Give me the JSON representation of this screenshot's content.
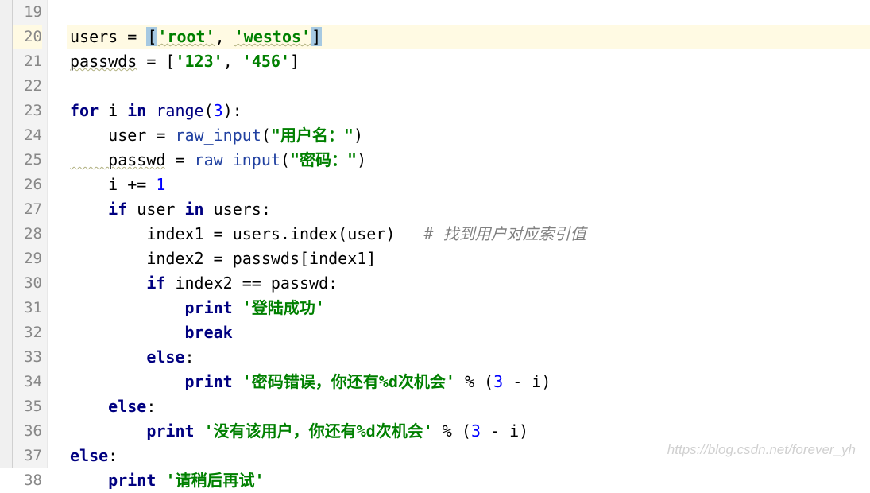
{
  "gutter": {
    "start": 19,
    "end": 38
  },
  "watermark": "https://blog.csdn.net/forever_yh",
  "code": {
    "l20_users": "users",
    "l20_eq": " = ",
    "l20_b1": "[",
    "l20_s1": "'root'",
    "l20_c": ", ",
    "l20_s2": "'westos'",
    "l20_b2": "]",
    "l21_passwds": "passwds",
    "l21_eq": " = [",
    "l21_s1": "'123'",
    "l21_c": ", ",
    "l21_s2": "'456'",
    "l21_b2": "]",
    "l23_for": "for",
    "l23_sp1": " i ",
    "l23_in": "in",
    "l23_sp2": " ",
    "l23_range": "range",
    "l23_p1": "(",
    "l23_n": "3",
    "l23_p2": "):",
    "l24_user": "    user = ",
    "l24_fn": "raw_input",
    "l24_p1": "(",
    "l24_s": "\"用户名：\"",
    "l24_p2": ")",
    "l25_passwd": "    passwd",
    "l25_eq": " = ",
    "l25_fn": "raw_input",
    "l25_p1": "(",
    "l25_s": "\"密码：\"",
    "l25_p2": ")",
    "l26_i": "    i += ",
    "l26_n": "1",
    "l27_if": "    if",
    "l27_rest": " user ",
    "l27_in": "in",
    "l27_users": " users:",
    "l28_idx": "        index1 = users.index(user)   ",
    "l28_comment": "# 找到用户对应索引值",
    "l29": "        index2 = passwds[index1]",
    "l30_if": "        if",
    "l30_rest": " index2 == passwd:",
    "l31_sp": "            ",
    "l31_print": "print",
    "l31_sp2": " ",
    "l31_s": "'登陆成功'",
    "l32_sp": "            ",
    "l32_break": "break",
    "l33_sp": "        ",
    "l33_else": "else",
    "l33_c": ":",
    "l34_sp": "            ",
    "l34_print": "print",
    "l34_sp2": " ",
    "l34_s": "'密码错误，你还有%d次机会'",
    "l34_rest": " % (",
    "l34_n": "3",
    "l34_rest2": " - i)",
    "l35_sp": "    ",
    "l35_else": "else",
    "l35_c": ":",
    "l36_sp": "        ",
    "l36_print": "print",
    "l36_sp2": " ",
    "l36_s": "'没有该用户，你还有%d次机会'",
    "l36_rest": " % (",
    "l36_n": "3",
    "l36_rest2": " - i)",
    "l37_else": "else",
    "l37_c": ":",
    "l38_sp": "    ",
    "l38_print": "print",
    "l38_sp2": " ",
    "l38_s": "'请稍后再试'"
  }
}
